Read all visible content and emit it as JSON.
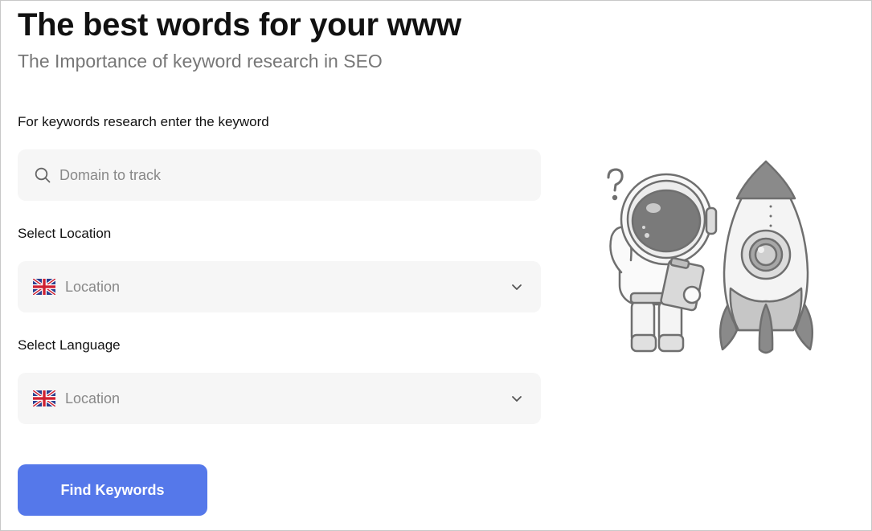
{
  "header": {
    "title": "The best words for your www",
    "subtitle": "The Importance of keyword research in SEO"
  },
  "form": {
    "keyword_label": "For keywords research enter the keyword",
    "keyword_placeholder": "Domain to track",
    "location_label": "Select Location",
    "location_value": "Location",
    "language_label": "Select Language",
    "language_value": "Location",
    "submit_label": "Find Keywords"
  },
  "icons": {
    "search": "search-icon",
    "flag": "uk-flag-icon",
    "chevron": "chevron-down-icon"
  },
  "colors": {
    "accent": "#5578ea",
    "field_bg": "#f6f6f6",
    "title": "#111111",
    "subtitle": "#777777"
  }
}
